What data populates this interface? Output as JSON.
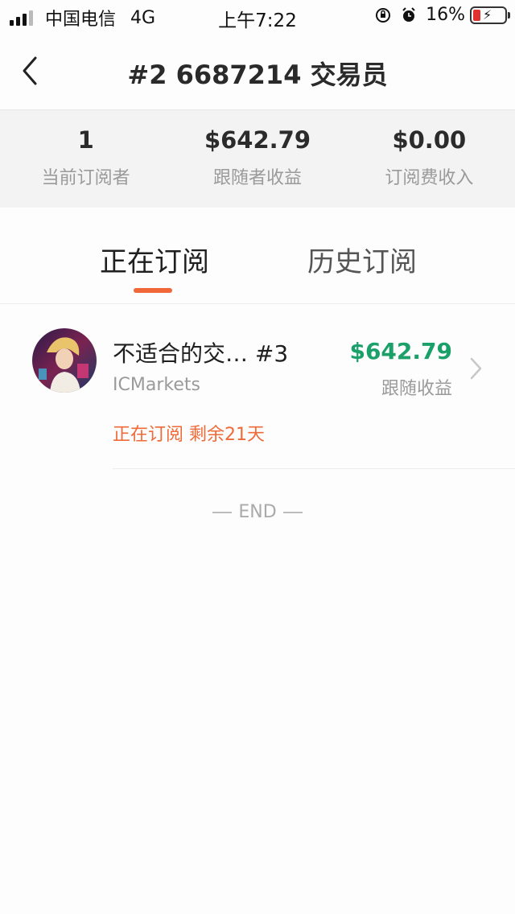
{
  "status_bar": {
    "carrier": "中国电信",
    "network": "4G",
    "time": "上午7:22",
    "battery": "16%"
  },
  "nav": {
    "title": "#2 6687214 交易员"
  },
  "stats": [
    {
      "value": "1",
      "label": "当前订阅者"
    },
    {
      "value": "$642.79",
      "label": "跟随者收益"
    },
    {
      "value": "$0.00",
      "label": "订阅费收入"
    }
  ],
  "tabs": {
    "active": "正在订阅",
    "history": "历史订阅"
  },
  "subscription": {
    "title": "不适合的交… #3",
    "broker": "ICMarkets",
    "status": "正在订阅 剩余21天",
    "profit": "$642.79",
    "profit_label": "跟随收益"
  },
  "end_text": "END",
  "colors": {
    "accent": "#f0673a",
    "profit_green": "#1ca06a",
    "battery_low": "#e0312f"
  }
}
